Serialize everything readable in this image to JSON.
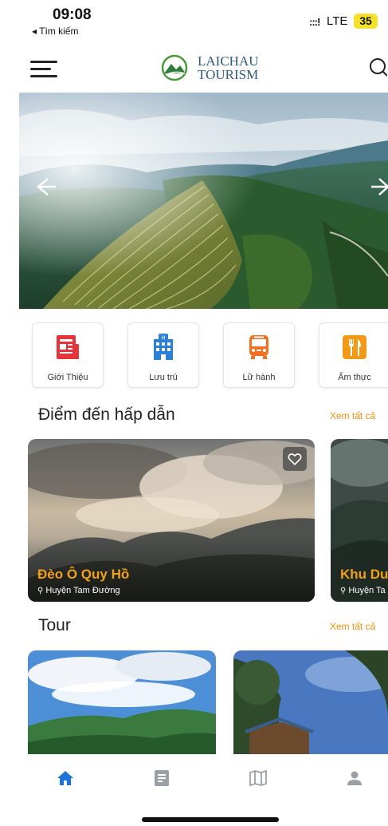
{
  "status_bar": {
    "time": "09:08",
    "back_label": "◂ Tìm kiếm",
    "signal": ":::!",
    "network": "LTE",
    "battery": "35"
  },
  "header": {
    "logo_line1": "LAICHAU",
    "logo_line2": "TOURISM"
  },
  "categories": [
    {
      "label": "Giới Thiệu",
      "icon": "newspaper-icon",
      "color": "#e8333a"
    },
    {
      "label": "Lưu trú",
      "icon": "hotel-icon",
      "color": "#2a7fd8"
    },
    {
      "label": "Lữ hành",
      "icon": "bus-icon",
      "color": "#f27020"
    },
    {
      "label": "Ẩm thực",
      "icon": "fork-knife-icon",
      "color": "#f29a18"
    }
  ],
  "destinations": {
    "title": "Điểm đến hấp dẫn",
    "see_all": "Xem tất cả",
    "items": [
      {
        "name": "Đèo Ô Quy Hồ",
        "location": "Huyện Tam Đường"
      },
      {
        "name": "Khu Du",
        "location": "Huyện Ta"
      }
    ]
  },
  "tours": {
    "title": "Tour",
    "see_all": "Xem tất cả"
  },
  "bottom_nav": [
    {
      "name": "home-icon",
      "active": true
    },
    {
      "name": "document-icon",
      "active": false
    },
    {
      "name": "map-icon",
      "active": false
    },
    {
      "name": "user-icon",
      "active": false
    }
  ],
  "colors": {
    "accent": "#f2900d",
    "nav_active": "#1e73d8",
    "nav_inactive": "#9aa0a6"
  }
}
